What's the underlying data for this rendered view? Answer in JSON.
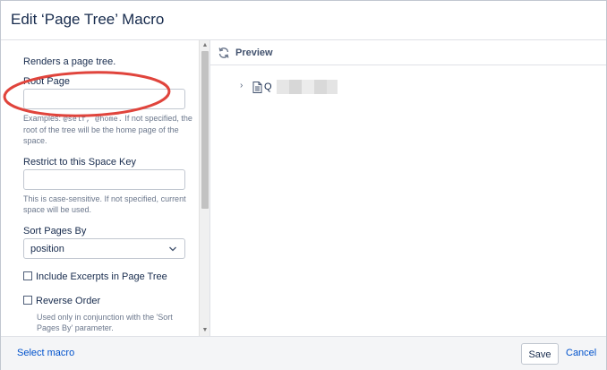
{
  "dialog": {
    "title": "Edit ‘Page Tree’ Macro"
  },
  "form": {
    "description": "Renders a page tree.",
    "root_page": {
      "label": "Root Page",
      "value": "",
      "help_prefix": "Examples: ",
      "help_code": "@self, @home.",
      "help_suffix": " If not specified, the root of the tree will be the home page of the space."
    },
    "space_key": {
      "label": "Restrict to this Space Key",
      "value": "",
      "help": "This is case-sensitive. If not specified, current space will be used."
    },
    "sort": {
      "label": "Sort Pages By",
      "selected": "position"
    },
    "include_excerpts": {
      "label": "Include Excerpts in Page Tree",
      "checked": false
    },
    "reverse_order": {
      "label": "Reverse Order",
      "checked": false,
      "help": "Used only in conjunction with the 'Sort Pages By' parameter."
    }
  },
  "preview": {
    "label": "Preview",
    "tree_item_text": "Q"
  },
  "footer": {
    "select_macro": "Select macro",
    "save": "Save",
    "cancel": "Cancel"
  },
  "colors": {
    "link": "#0052cc",
    "annotation": "#e0443c"
  },
  "icons": {
    "refresh": "refresh-icon",
    "page": "page-icon",
    "chevron_right": "chevron-right-icon",
    "chevron_down": "chevron-down-icon"
  }
}
